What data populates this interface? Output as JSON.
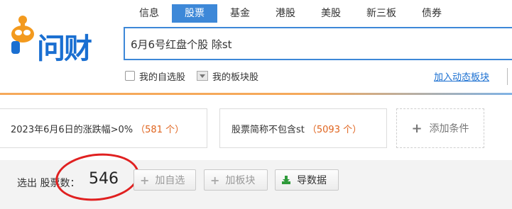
{
  "logo": {
    "text": "问财",
    "icon": "mascot-icon"
  },
  "nav": {
    "items": [
      {
        "label": "信息",
        "active": false
      },
      {
        "label": "股票",
        "active": true
      },
      {
        "label": "基金",
        "active": false
      },
      {
        "label": "港股",
        "active": false
      },
      {
        "label": "美股",
        "active": false
      },
      {
        "label": "新三板",
        "active": false
      },
      {
        "label": "债券",
        "active": false
      }
    ]
  },
  "search": {
    "value": "6月6号红盘个股 除st",
    "placeholder": ""
  },
  "options": {
    "my_stocks_label": "我的自选股",
    "my_sectors_label": "我的板块股",
    "add_sector_link": "加入动态板块"
  },
  "conditions": [
    {
      "text": "2023年6月6日的涨跌幅>0%",
      "count": "（581 个）"
    },
    {
      "text": "股票简称不包含st",
      "count": "（5093 个）"
    }
  ],
  "add_condition_label": "添加条件",
  "result": {
    "label": "选出 股票数：",
    "count": "546",
    "buttons": {
      "add_watchlist": "加自选",
      "add_sector": "加板块",
      "export": "导数据"
    }
  },
  "colors": {
    "brand_blue": "#1a6fd1",
    "active_tab": "#3d88d8",
    "count_orange": "#e0641e",
    "highlight_red": "#e02020",
    "logo_orange": "#f39a1e",
    "export_green": "#2f9a3a"
  }
}
